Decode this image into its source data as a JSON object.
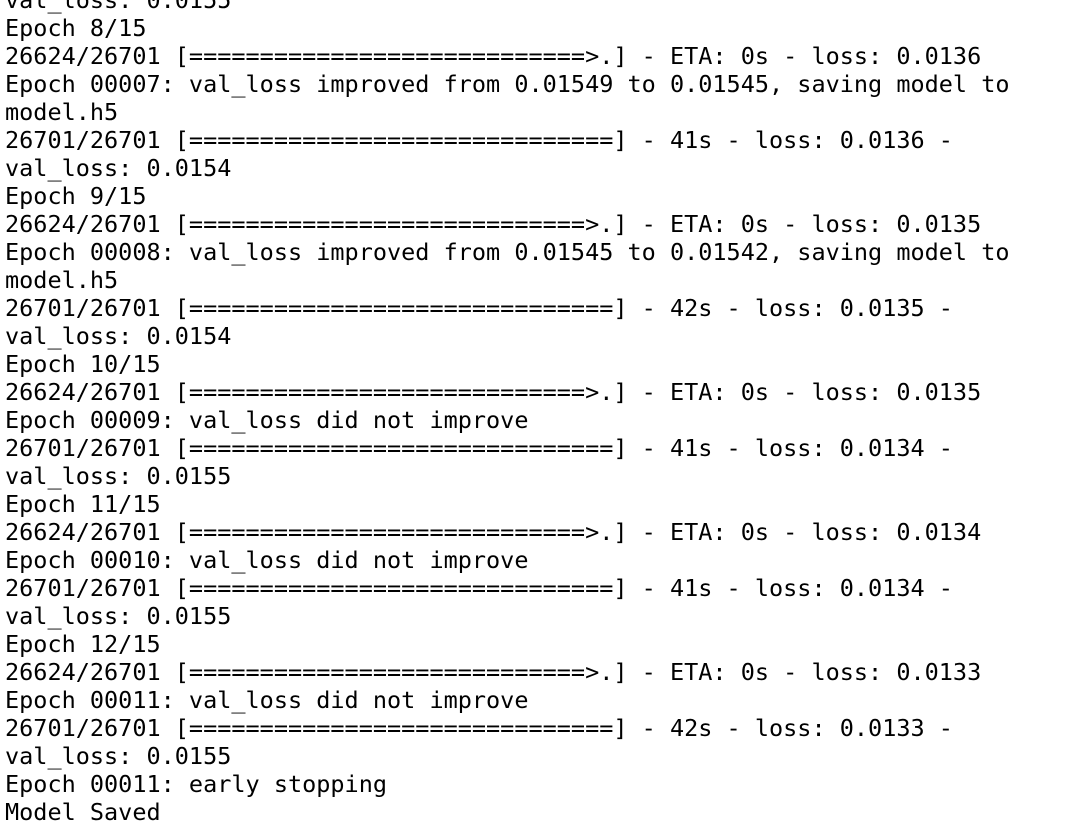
{
  "terminal": {
    "background": "#ffffff",
    "text_color": "#000000",
    "lines": [
      "val_loss: 0.0155",
      "Epoch 8/15",
      "26624/26701 [============================>.] - ETA: 0s - loss: 0.0136",
      "Epoch 00007: val_loss improved from 0.01549 to 0.01545, saving model to",
      "model.h5",
      "26701/26701 [==============================] - 41s - loss: 0.0136 -",
      "val_loss: 0.0154",
      "Epoch 9/15",
      "26624/26701 [============================>.] - ETA: 0s - loss: 0.0135",
      "Epoch 00008: val_loss improved from 0.01545 to 0.01542, saving model to",
      "model.h5",
      "26701/26701 [==============================] - 42s - loss: 0.0135 -",
      "val_loss: 0.0154",
      "Epoch 10/15",
      "26624/26701 [============================>.] - ETA: 0s - loss: 0.0135",
      "Epoch 00009: val_loss did not improve",
      "26701/26701 [==============================] - 41s - loss: 0.0134 -",
      "val_loss: 0.0155",
      "Epoch 11/15",
      "26624/26701 [============================>.] - ETA: 0s - loss: 0.0134",
      "Epoch 00010: val_loss did not improve",
      "26701/26701 [==============================] - 41s - loss: 0.0134 -",
      "val_loss: 0.0155",
      "Epoch 12/15",
      "26624/26701 [============================>.] - ETA: 0s - loss: 0.0133",
      "Epoch 00011: val_loss did not improve",
      "26701/26701 [==============================] - 42s - loss: 0.0133 -",
      "val_loss: 0.0155",
      "Epoch 00011: early stopping",
      "Model Saved"
    ]
  }
}
